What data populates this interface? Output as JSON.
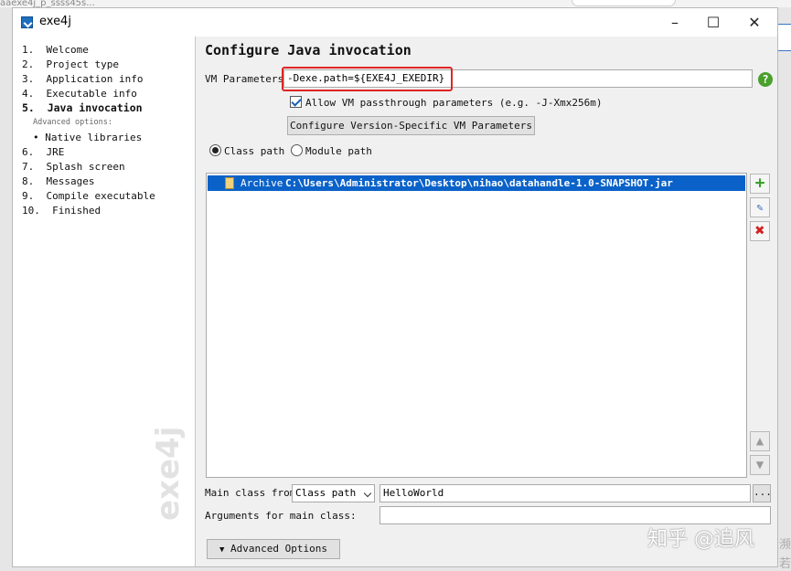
{
  "window": {
    "title": "exe4j",
    "minimize": "–",
    "maximize": "☐",
    "close": "✕"
  },
  "top_strip_text": "aaexe4j_p_ssss45s...",
  "steps": [
    {
      "label": "1.  Welcome"
    },
    {
      "label": "2.  Project type"
    },
    {
      "label": "3.  Application info"
    },
    {
      "label": "4.  Executable info"
    },
    {
      "label": "5.  Java invocation"
    },
    {
      "label": "Advanced options:"
    },
    {
      "label": "• Native libraries"
    },
    {
      "label": "6.  JRE"
    },
    {
      "label": "7.  Splash screen"
    },
    {
      "label": "8.  Messages"
    },
    {
      "label": "9.  Compile executable"
    },
    {
      "label": "10.  Finished"
    }
  ],
  "sidebar_watermark": "exe4j",
  "page": {
    "heading": "Configure Java invocation",
    "vm_label": "VM Parameters:",
    "vm_value": "-Dexe.path=${EXE4J_EXEDIR}",
    "help": "?",
    "allow_passthrough_label": "Allow VM passthrough parameters (e.g. -J-Xmx256m)",
    "allow_passthrough_checked": true,
    "version_button": "Configure Version-Specific VM Parameters",
    "classpath_radio": "Class path",
    "modulepath_radio": "Module path",
    "selected_mode": "Class path",
    "classpath_entries": [
      {
        "type": "Archive",
        "path": "C:\\Users\\Administrator\\Desktop\\nihao\\datahandle-1.0-SNAPSHOT.jar"
      }
    ],
    "main_class_label": "Main class from",
    "main_class_source": "Class path",
    "main_class_value": "HelloWorld",
    "browse_button": "...",
    "arguments_label": "Arguments for main class:",
    "arguments_value": "",
    "advanced_button": "Advanced Options"
  },
  "overlay_watermark": "知乎 @追风",
  "edge_chars": [
    "濒",
    "若"
  ],
  "colors": {
    "selection": "#0a62c9",
    "highlight_box": "#e02525",
    "add": "#3aa12a",
    "remove": "#d42020"
  }
}
